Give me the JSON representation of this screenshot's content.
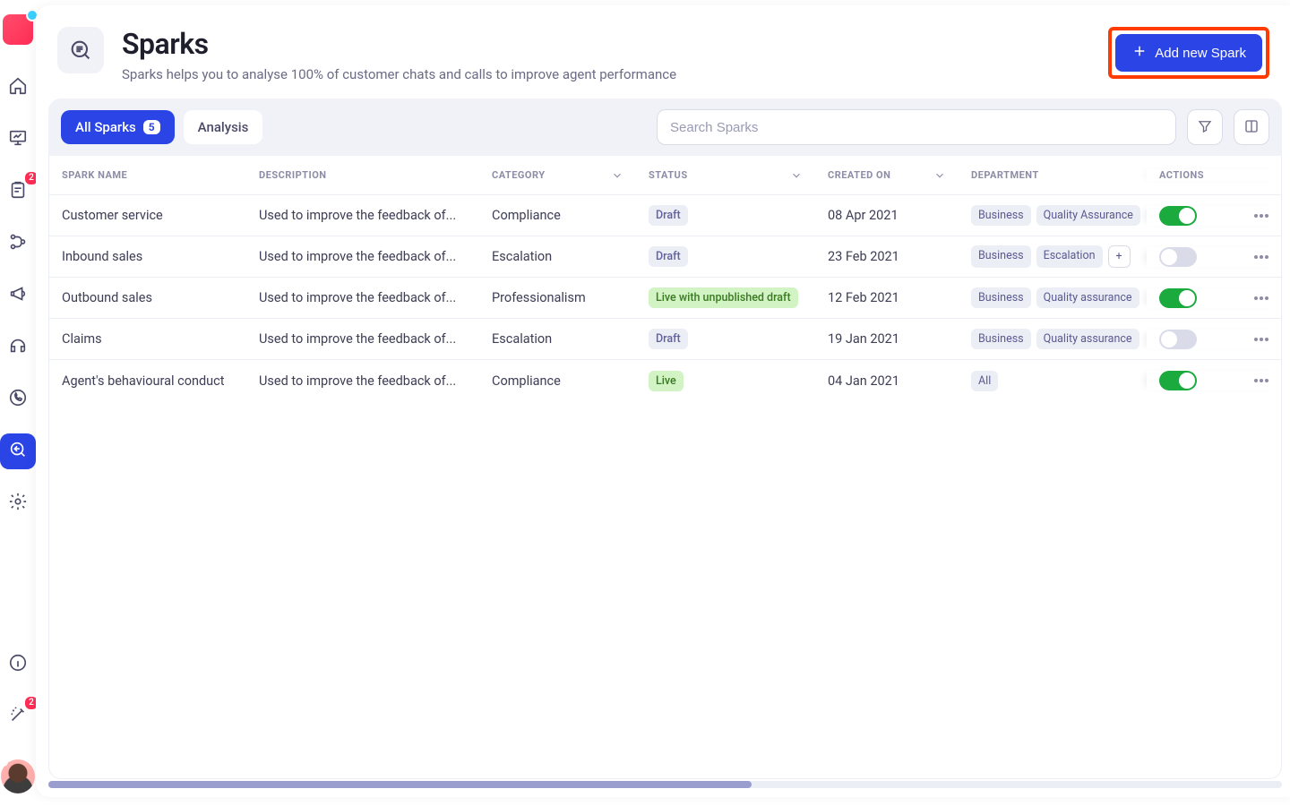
{
  "sidebar": {
    "badges": {
      "clipboard": "2",
      "wand": "2"
    }
  },
  "header": {
    "title": "Sparks",
    "subtitle": "Sparks helps you to analyse 100% of customer chats and calls to improve agent performance",
    "add_button": "Add new Spark"
  },
  "toolbar": {
    "tab_all": "All Sparks",
    "tab_all_count": "5",
    "tab_analysis": "Analysis",
    "search_placeholder": "Search Sparks"
  },
  "table": {
    "columns": {
      "name": "SPARK NAME",
      "description": "DESCRIPTION",
      "category": "CATEGORY",
      "status": "STATUS",
      "created": "CREATED ON",
      "department": "DEPARTMENT",
      "actions": "ACTIONS"
    },
    "rows": [
      {
        "name": "Customer service",
        "description": "Used to improve the feedback of...",
        "category": "Compliance",
        "status": "Draft",
        "status_kind": "draft",
        "created": "08 Apr 2021",
        "departments": [
          "Business",
          "Quality Assurance"
        ],
        "toggle": true
      },
      {
        "name": "Inbound sales",
        "description": "Used to improve the feedback of...",
        "category": "Escalation",
        "status": "Draft",
        "status_kind": "draft",
        "created": "23 Feb 2021",
        "departments": [
          "Business",
          "Escalation"
        ],
        "extra": "+",
        "toggle": false
      },
      {
        "name": "Outbound sales",
        "description": "Used to improve the feedback of...",
        "category": "Professionalism",
        "status": "Live with unpublished draft",
        "status_kind": "livedraft",
        "created": "12 Feb 2021",
        "departments": [
          "Business",
          "Quality assurance"
        ],
        "toggle": true
      },
      {
        "name": "Claims",
        "description": "Used to improve the feedback of...",
        "category": "Escalation",
        "status": "Draft",
        "status_kind": "draft",
        "created": "19 Jan 2021",
        "departments": [
          "Business",
          "Quality assurance"
        ],
        "toggle": false
      },
      {
        "name": "Agent's behavioural conduct",
        "description": "Used to improve the feedback of...",
        "category": "Compliance",
        "status": "Live",
        "status_kind": "live",
        "created": "04 Jan 2021",
        "departments": [
          "All"
        ],
        "toggle": true
      }
    ]
  }
}
